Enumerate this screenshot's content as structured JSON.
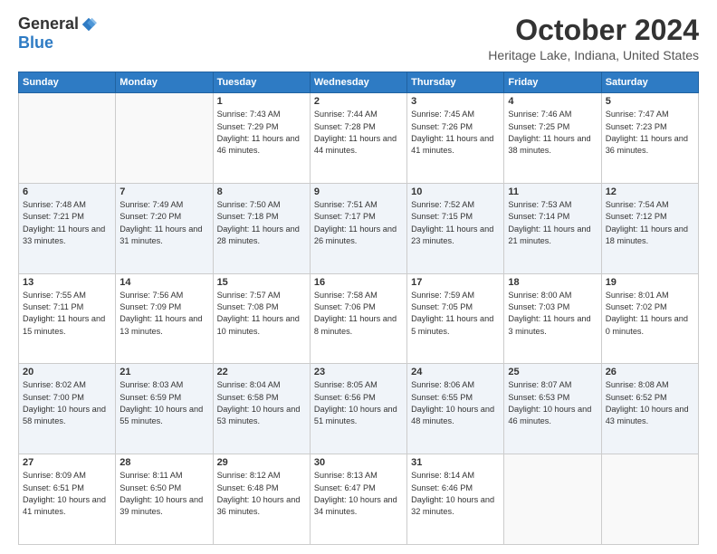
{
  "logo": {
    "general": "General",
    "blue": "Blue"
  },
  "header": {
    "month": "October 2024",
    "location": "Heritage Lake, Indiana, United States"
  },
  "days_of_week": [
    "Sunday",
    "Monday",
    "Tuesday",
    "Wednesday",
    "Thursday",
    "Friday",
    "Saturday"
  ],
  "weeks": [
    [
      {
        "day": "",
        "info": ""
      },
      {
        "day": "",
        "info": ""
      },
      {
        "day": "1",
        "sunrise": "7:43 AM",
        "sunset": "7:29 PM",
        "daylight": "11 hours and 46 minutes."
      },
      {
        "day": "2",
        "sunrise": "7:44 AM",
        "sunset": "7:28 PM",
        "daylight": "11 hours and 44 minutes."
      },
      {
        "day": "3",
        "sunrise": "7:45 AM",
        "sunset": "7:26 PM",
        "daylight": "11 hours and 41 minutes."
      },
      {
        "day": "4",
        "sunrise": "7:46 AM",
        "sunset": "7:25 PM",
        "daylight": "11 hours and 38 minutes."
      },
      {
        "day": "5",
        "sunrise": "7:47 AM",
        "sunset": "7:23 PM",
        "daylight": "11 hours and 36 minutes."
      }
    ],
    [
      {
        "day": "6",
        "sunrise": "7:48 AM",
        "sunset": "7:21 PM",
        "daylight": "11 hours and 33 minutes."
      },
      {
        "day": "7",
        "sunrise": "7:49 AM",
        "sunset": "7:20 PM",
        "daylight": "11 hours and 31 minutes."
      },
      {
        "day": "8",
        "sunrise": "7:50 AM",
        "sunset": "7:18 PM",
        "daylight": "11 hours and 28 minutes."
      },
      {
        "day": "9",
        "sunrise": "7:51 AM",
        "sunset": "7:17 PM",
        "daylight": "11 hours and 26 minutes."
      },
      {
        "day": "10",
        "sunrise": "7:52 AM",
        "sunset": "7:15 PM",
        "daylight": "11 hours and 23 minutes."
      },
      {
        "day": "11",
        "sunrise": "7:53 AM",
        "sunset": "7:14 PM",
        "daylight": "11 hours and 21 minutes."
      },
      {
        "day": "12",
        "sunrise": "7:54 AM",
        "sunset": "7:12 PM",
        "daylight": "11 hours and 18 minutes."
      }
    ],
    [
      {
        "day": "13",
        "sunrise": "7:55 AM",
        "sunset": "7:11 PM",
        "daylight": "11 hours and 15 minutes."
      },
      {
        "day": "14",
        "sunrise": "7:56 AM",
        "sunset": "7:09 PM",
        "daylight": "11 hours and 13 minutes."
      },
      {
        "day": "15",
        "sunrise": "7:57 AM",
        "sunset": "7:08 PM",
        "daylight": "11 hours and 10 minutes."
      },
      {
        "day": "16",
        "sunrise": "7:58 AM",
        "sunset": "7:06 PM",
        "daylight": "11 hours and 8 minutes."
      },
      {
        "day": "17",
        "sunrise": "7:59 AM",
        "sunset": "7:05 PM",
        "daylight": "11 hours and 5 minutes."
      },
      {
        "day": "18",
        "sunrise": "8:00 AM",
        "sunset": "7:03 PM",
        "daylight": "11 hours and 3 minutes."
      },
      {
        "day": "19",
        "sunrise": "8:01 AM",
        "sunset": "7:02 PM",
        "daylight": "11 hours and 0 minutes."
      }
    ],
    [
      {
        "day": "20",
        "sunrise": "8:02 AM",
        "sunset": "7:00 PM",
        "daylight": "10 hours and 58 minutes."
      },
      {
        "day": "21",
        "sunrise": "8:03 AM",
        "sunset": "6:59 PM",
        "daylight": "10 hours and 55 minutes."
      },
      {
        "day": "22",
        "sunrise": "8:04 AM",
        "sunset": "6:58 PM",
        "daylight": "10 hours and 53 minutes."
      },
      {
        "day": "23",
        "sunrise": "8:05 AM",
        "sunset": "6:56 PM",
        "daylight": "10 hours and 51 minutes."
      },
      {
        "day": "24",
        "sunrise": "8:06 AM",
        "sunset": "6:55 PM",
        "daylight": "10 hours and 48 minutes."
      },
      {
        "day": "25",
        "sunrise": "8:07 AM",
        "sunset": "6:53 PM",
        "daylight": "10 hours and 46 minutes."
      },
      {
        "day": "26",
        "sunrise": "8:08 AM",
        "sunset": "6:52 PM",
        "daylight": "10 hours and 43 minutes."
      }
    ],
    [
      {
        "day": "27",
        "sunrise": "8:09 AM",
        "sunset": "6:51 PM",
        "daylight": "10 hours and 41 minutes."
      },
      {
        "day": "28",
        "sunrise": "8:11 AM",
        "sunset": "6:50 PM",
        "daylight": "10 hours and 39 minutes."
      },
      {
        "day": "29",
        "sunrise": "8:12 AM",
        "sunset": "6:48 PM",
        "daylight": "10 hours and 36 minutes."
      },
      {
        "day": "30",
        "sunrise": "8:13 AM",
        "sunset": "6:47 PM",
        "daylight": "10 hours and 34 minutes."
      },
      {
        "day": "31",
        "sunrise": "8:14 AM",
        "sunset": "6:46 PM",
        "daylight": "10 hours and 32 minutes."
      },
      {
        "day": "",
        "info": ""
      },
      {
        "day": "",
        "info": ""
      }
    ]
  ]
}
